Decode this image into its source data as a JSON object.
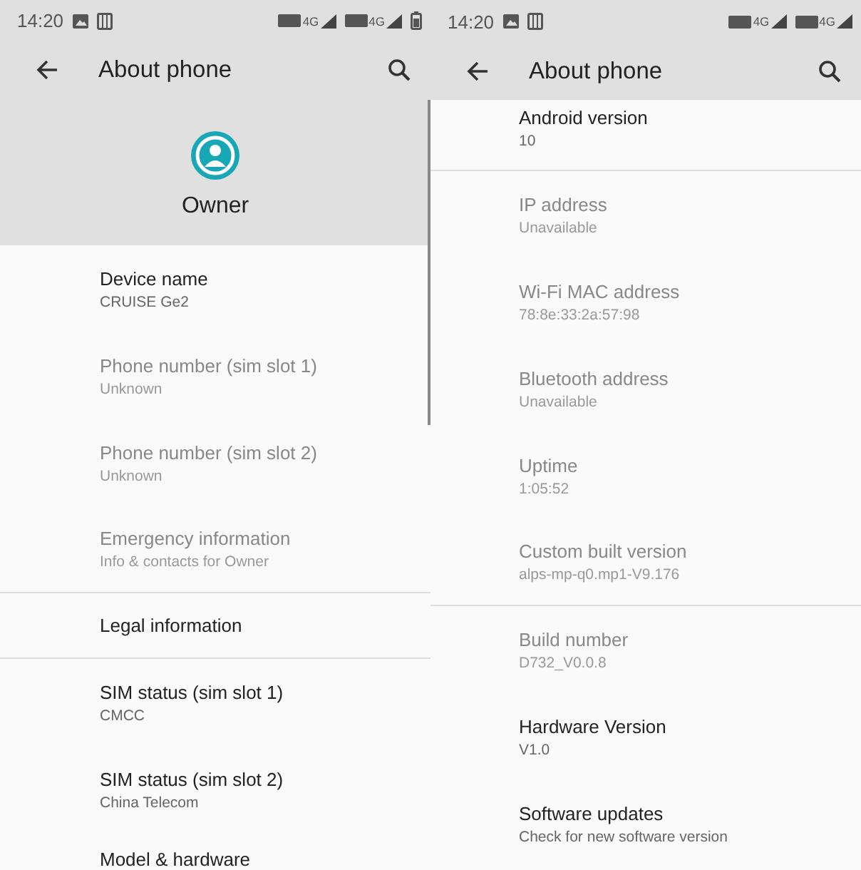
{
  "screens": [
    {
      "status_bar": {
        "time": "14:20",
        "network": [
          "4G",
          "4G"
        ]
      },
      "toolbar": {
        "title": "About phone"
      },
      "header": {
        "owner": "Owner"
      },
      "items": [
        {
          "title": "Device name",
          "summary": "CRUISE Ge2",
          "disabled": false,
          "divider_below": false
        },
        {
          "title": "Phone number (sim slot 1)",
          "summary": "Unknown",
          "disabled": true,
          "divider_below": false
        },
        {
          "title": "Phone number (sim slot 2)",
          "summary": "Unknown",
          "disabled": true,
          "divider_below": false
        },
        {
          "title": "Emergency information",
          "summary": "Info & contacts for Owner",
          "disabled": true,
          "divider_below": true
        },
        {
          "title": "Legal information",
          "disabled": false,
          "divider_below": true
        },
        {
          "title": "SIM status (sim slot 1)",
          "summary": "CMCC",
          "disabled": false,
          "divider_below": false
        },
        {
          "title": "SIM status (sim slot 2)",
          "summary": "China Telecom",
          "disabled": false,
          "divider_below": false
        },
        {
          "title": "Model & hardware",
          "disabled": false,
          "divider_below": false
        }
      ]
    },
    {
      "status_bar": {
        "time": "14:20",
        "network": [
          "4G",
          "4G"
        ]
      },
      "toolbar": {
        "title": "About phone"
      },
      "items": [
        {
          "title": "Android version",
          "summary": "10",
          "disabled": false,
          "divider_below": true
        },
        {
          "title": "IP address",
          "summary": "Unavailable",
          "disabled": true,
          "divider_below": false
        },
        {
          "title": "Wi-Fi MAC address",
          "summary": "78:8e:33:2a:57:98",
          "disabled": true,
          "divider_below": false
        },
        {
          "title": "Bluetooth address",
          "summary": "Unavailable",
          "disabled": true,
          "divider_below": false
        },
        {
          "title": "Uptime",
          "summary": "1:05:52",
          "disabled": true,
          "divider_below": false
        },
        {
          "title": "Custom built version",
          "summary": "alps-mp-q0.mp1-V9.176",
          "disabled": true,
          "divider_below": true
        },
        {
          "title": "Build number",
          "summary": "D732_V0.0.8",
          "disabled": true,
          "divider_below": false
        },
        {
          "title": "Hardware Version",
          "summary": "V1.0",
          "disabled": false,
          "divider_below": false
        },
        {
          "title": "Software updates",
          "summary": "Check for new software version",
          "disabled": false,
          "divider_below": false
        }
      ]
    }
  ]
}
